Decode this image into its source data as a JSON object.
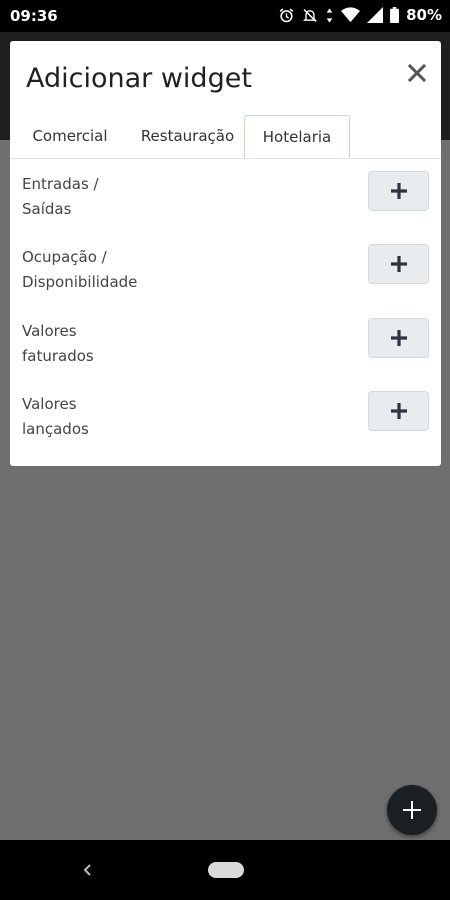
{
  "status_bar": {
    "time": "09:36",
    "battery": "80%",
    "icons": [
      "alarm-icon",
      "mute-icon",
      "data-icon",
      "wifi-icon",
      "signal-icon",
      "battery-icon"
    ]
  },
  "dialog": {
    "title": "Adicionar widget",
    "close_icon": "close-icon",
    "tabs": [
      {
        "label": "Comercial",
        "active": false
      },
      {
        "label": "Restauração",
        "active": false
      },
      {
        "label": "Hotelaria",
        "active": true
      }
    ],
    "widgets": [
      {
        "line1": "Entradas /",
        "line2": "Saídas"
      },
      {
        "line1": "Ocupação /",
        "line2": "Disponibilidade"
      },
      {
        "line1": "Valores",
        "line2": "faturados"
      },
      {
        "line1": "Valores",
        "line2": "lançados"
      }
    ],
    "add_icon": "plus-icon"
  },
  "fab": {
    "icon": "plus-icon"
  },
  "colors": {
    "overlay": "#6f6f6f",
    "active_tab_border": "#f0c8a8",
    "fab": "#1a1f24",
    "add_button_bg": "#e9ecef"
  }
}
